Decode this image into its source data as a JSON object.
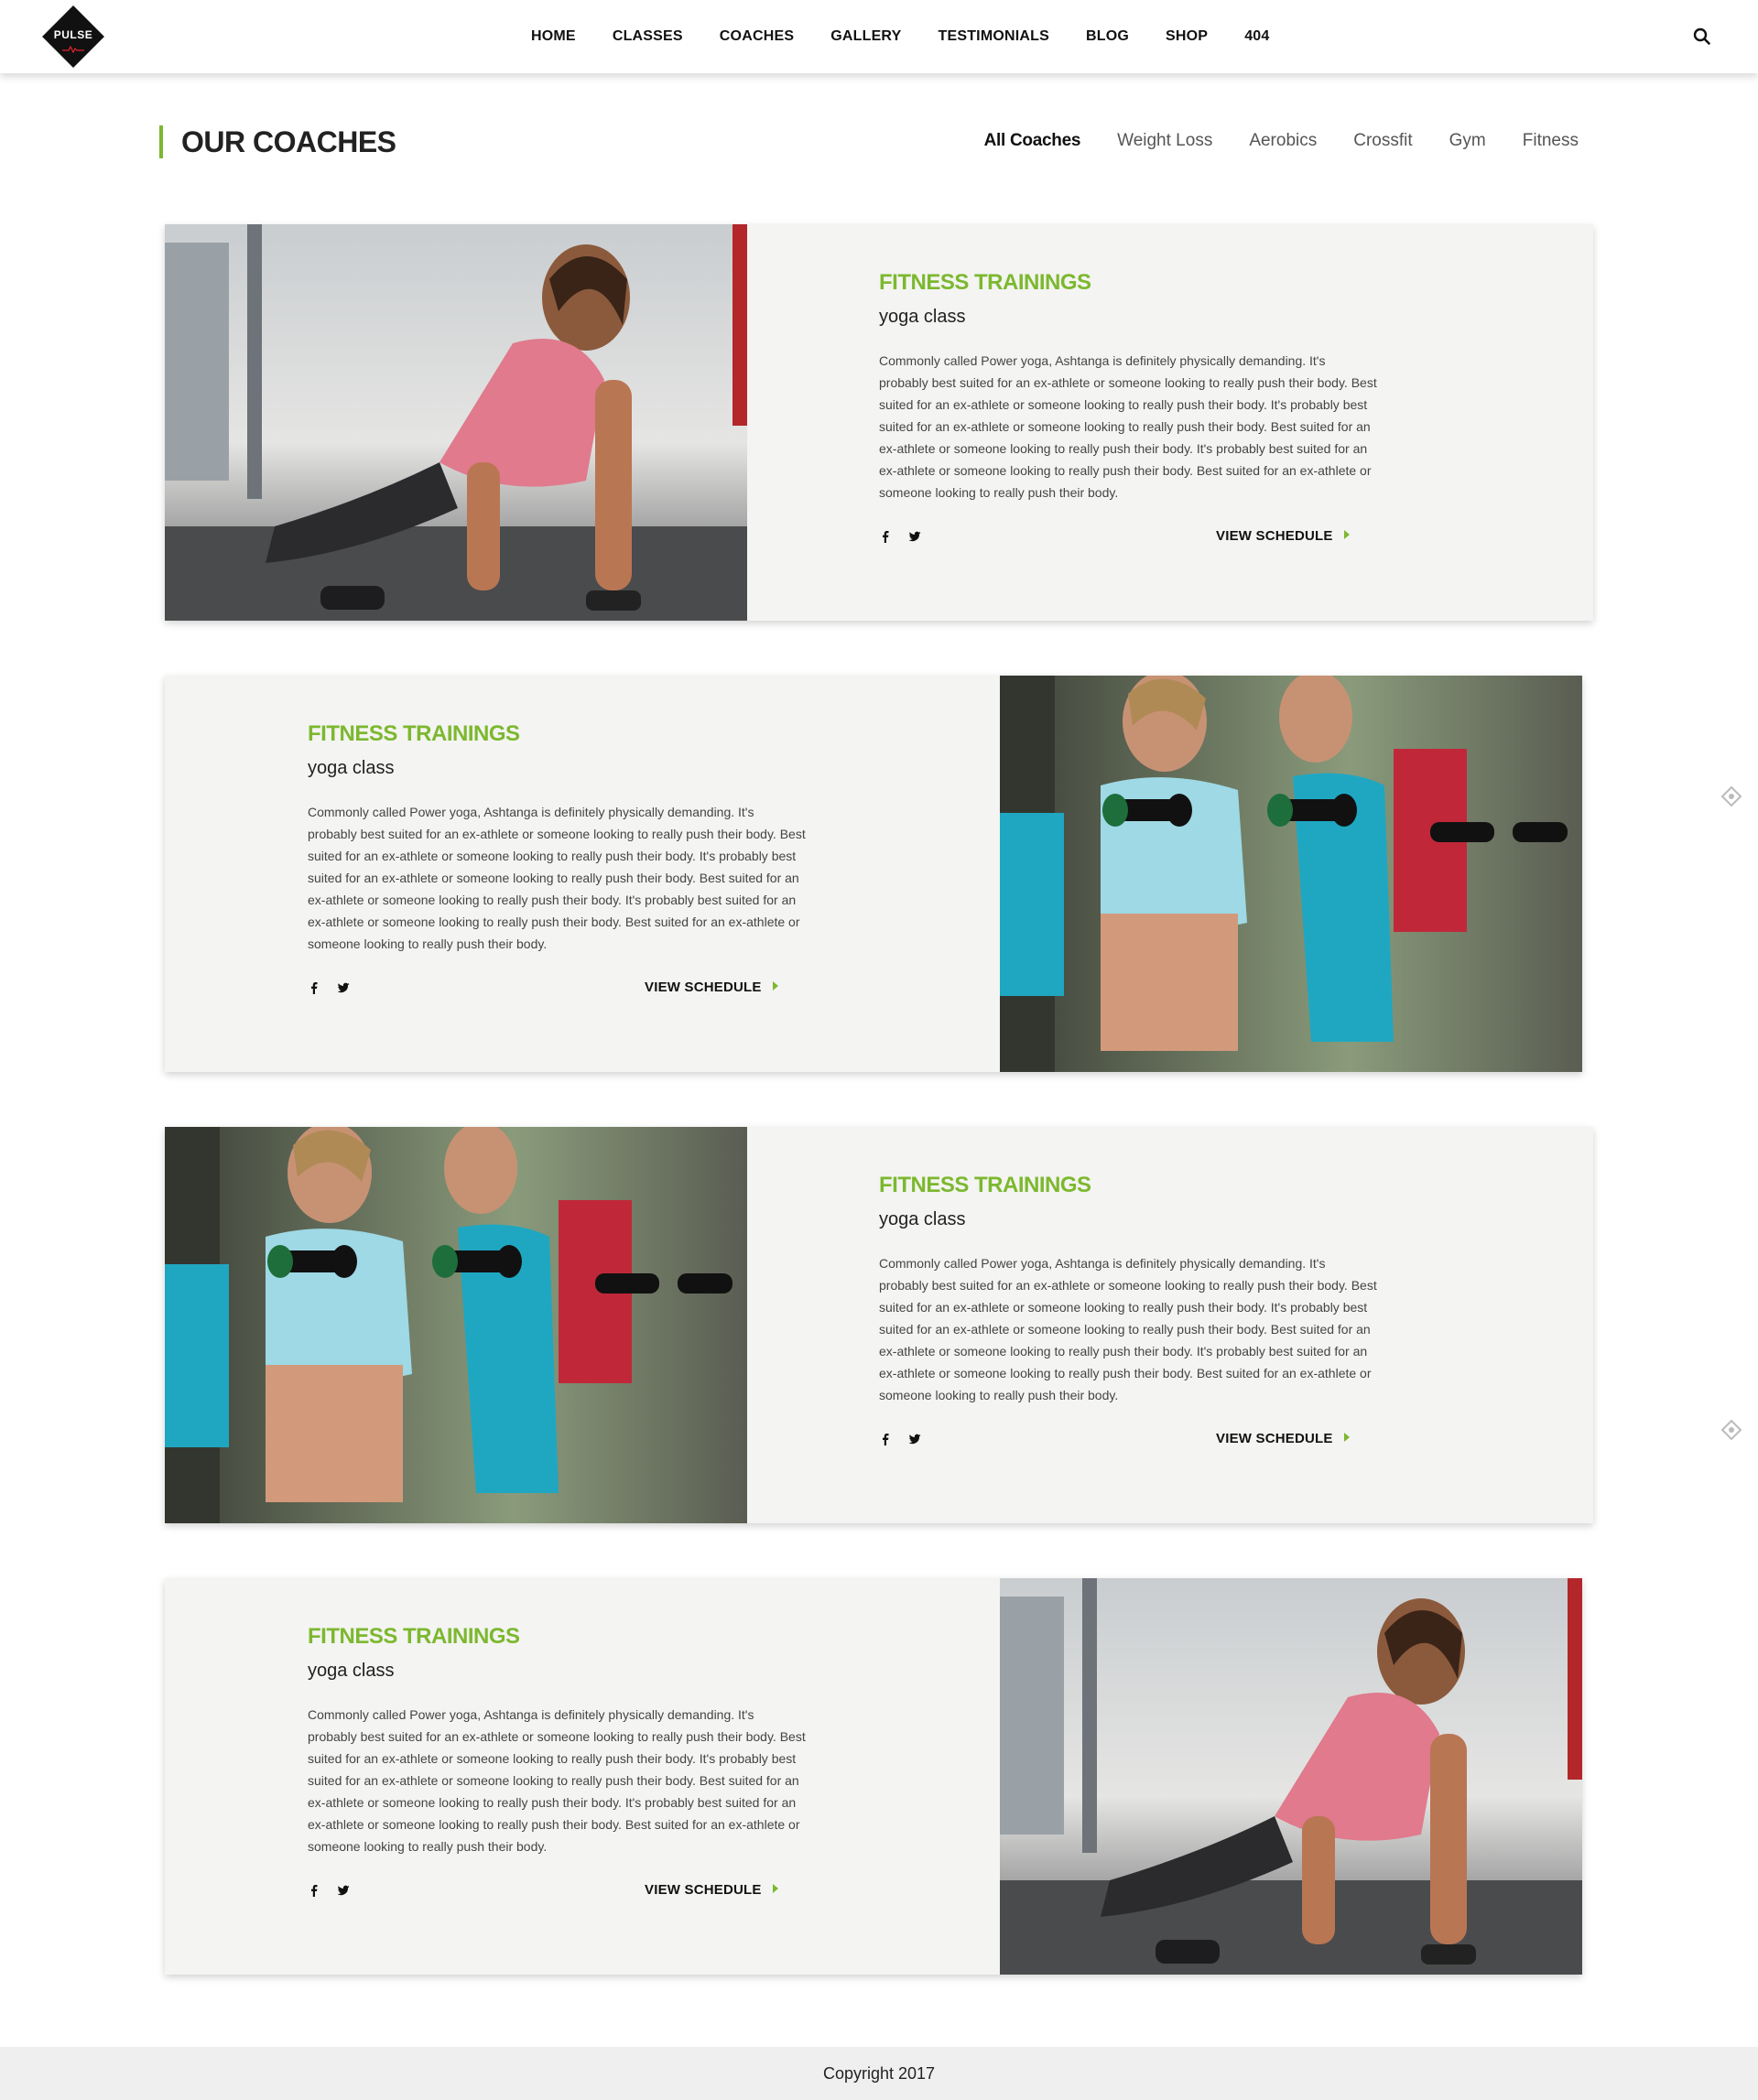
{
  "brand": {
    "logo_text": "PULSE"
  },
  "nav": {
    "items": [
      "HOME",
      "CLASSES",
      "COACHES",
      "GALLERY",
      "TESTIMONIALS",
      "BLOG",
      "SHOP",
      "404"
    ]
  },
  "section": {
    "title": "OUR COACHES",
    "filters": [
      "All Coaches",
      "Weight Loss",
      "Aerobics",
      "Crossfit",
      "Gym",
      "Fitness"
    ],
    "active_filter": "All Coaches"
  },
  "cards": [
    {
      "title": "FITNESS TRAININGS",
      "subtitle": "yoga class",
      "text": "Commonly called Power yoga, Ashtanga is definitely physically demanding. It's probably best suited for an ex-athlete or someone looking to really push their body. Best suited for an ex-athlete or someone looking to really push their body. It's probably best suited for an ex-athlete or someone looking to really push their body. Best suited for an ex-athlete or someone looking to really push their body. It's probably best suited for an ex-athlete or someone looking to really push their body. Best suited for an ex-athlete or someone looking to really push their body.",
      "cta": "VIEW SCHEDULE",
      "image": "woman-pushup-photo"
    },
    {
      "title": "FITNESS TRAININGS",
      "subtitle": "yoga class",
      "text": "Commonly called Power yoga, Ashtanga is definitely physically demanding. It's probably best suited for an ex-athlete or someone looking to really push their body. Best suited for an ex-athlete or someone looking to really push their body. It's probably best suited for an ex-athlete or someone looking to really push their body. Best suited for an ex-athlete or someone looking to really push their body. It's probably best suited for an ex-athlete or someone looking to really push their body. Best suited for an ex-athlete or someone looking to really push their body.",
      "cta": "VIEW SCHEDULE",
      "image": "women-dumbbells-photo"
    },
    {
      "title": "FITNESS TRAININGS",
      "subtitle": "yoga class",
      "text": "Commonly called Power yoga, Ashtanga is definitely physically demanding. It's probably best suited for an ex-athlete or someone looking to really push their body. Best suited for an ex-athlete or someone looking to really push their body. It's probably best suited for an ex-athlete or someone looking to really push their body. Best suited for an ex-athlete or someone looking to really push their body. It's probably best suited for an ex-athlete or someone looking to really push their body. Best suited for an ex-athlete or someone looking to really push their body.",
      "cta": "VIEW SCHEDULE",
      "image": "women-dumbbells-photo"
    },
    {
      "title": "FITNESS TRAININGS",
      "subtitle": "yoga class",
      "text": "Commonly called Power yoga, Ashtanga is definitely physically demanding. It's probably best suited for an ex-athlete or someone looking to really push their body. Best suited for an ex-athlete or someone looking to really push their body. It's probably best suited for an ex-athlete or someone looking to really push their body. Best suited for an ex-athlete or someone looking to really push their body. It's probably best suited for an ex-athlete or someone looking to really push their body. Best suited for an ex-athlete or someone looking to really push their body.",
      "cta": "VIEW SCHEDULE",
      "image": "woman-pushup-photo"
    }
  ],
  "footer": {
    "copyright": "Copyright 2017"
  },
  "colors": {
    "accent": "#7cb82f",
    "card_bg": "#f4f4f2",
    "footer_bg": "#efefef"
  }
}
